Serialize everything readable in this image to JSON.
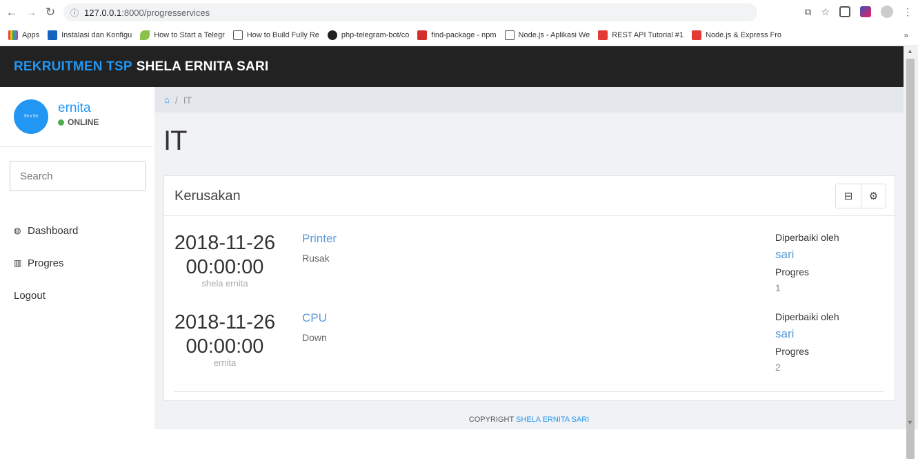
{
  "browser": {
    "url_host": "127.0.0.1",
    "url_path": ":8000/progresservices",
    "bookmarks": [
      {
        "label": "Apps",
        "color": "#e8453c"
      },
      {
        "label": "Instalasi dan Konfigu",
        "color": "#1565c0"
      },
      {
        "label": "How to Start a Telegr",
        "color": "#8bc34a"
      },
      {
        "label": "How to Build Fully Re",
        "color": "#555555"
      },
      {
        "label": "php-telegram-bot/co",
        "color": "#222222"
      },
      {
        "label": "find-package - npm",
        "color": "#d32f2f"
      },
      {
        "label": "Node.js - Aplikasi We",
        "color": "#555555"
      },
      {
        "label": "REST API Tutorial #1",
        "color": "#e53935"
      },
      {
        "label": "Node.js & Express Fro",
        "color": "#e53935"
      }
    ],
    "more": "»"
  },
  "header": {
    "brand_a": "REKRUITMEN TSP",
    "brand_b": "SHELA ERNITA SARI"
  },
  "sidebar": {
    "avatar_text": "50 x 50",
    "username": "ernita",
    "status": "ONLINE",
    "search_placeholder": "Search",
    "menu": [
      {
        "icon": "dashboard-icon",
        "label": "Dashboard"
      },
      {
        "icon": "bar-chart-icon",
        "label": "Progres"
      },
      {
        "icon": "",
        "label": "Logout"
      }
    ]
  },
  "breadcrumb": {
    "sep": "/",
    "current": "IT"
  },
  "page": {
    "title": "IT"
  },
  "panel": {
    "title": "Kerusakan",
    "entries": [
      {
        "date": "2018-11-26",
        "time": "00:00:00",
        "user": "shela ernita",
        "item": "Printer",
        "desc": "Rusak",
        "fixed_label": "Diperbaiki oleh",
        "fixer": "sari",
        "progress_label": "Progres",
        "progress": "1"
      },
      {
        "date": "2018-11-26",
        "time": "00:00:00",
        "user": "ernita",
        "item": "CPU",
        "desc": "Down",
        "fixed_label": "Diperbaiki oleh",
        "fixer": "sari",
        "progress_label": "Progres",
        "progress": "2"
      }
    ]
  },
  "footer": {
    "prefix": "COPYRIGHT",
    "name": "SHELA ERNITA SARI"
  },
  "colors": {
    "accent": "#2196f3",
    "header_bg": "#222222",
    "online": "#4caf50"
  }
}
